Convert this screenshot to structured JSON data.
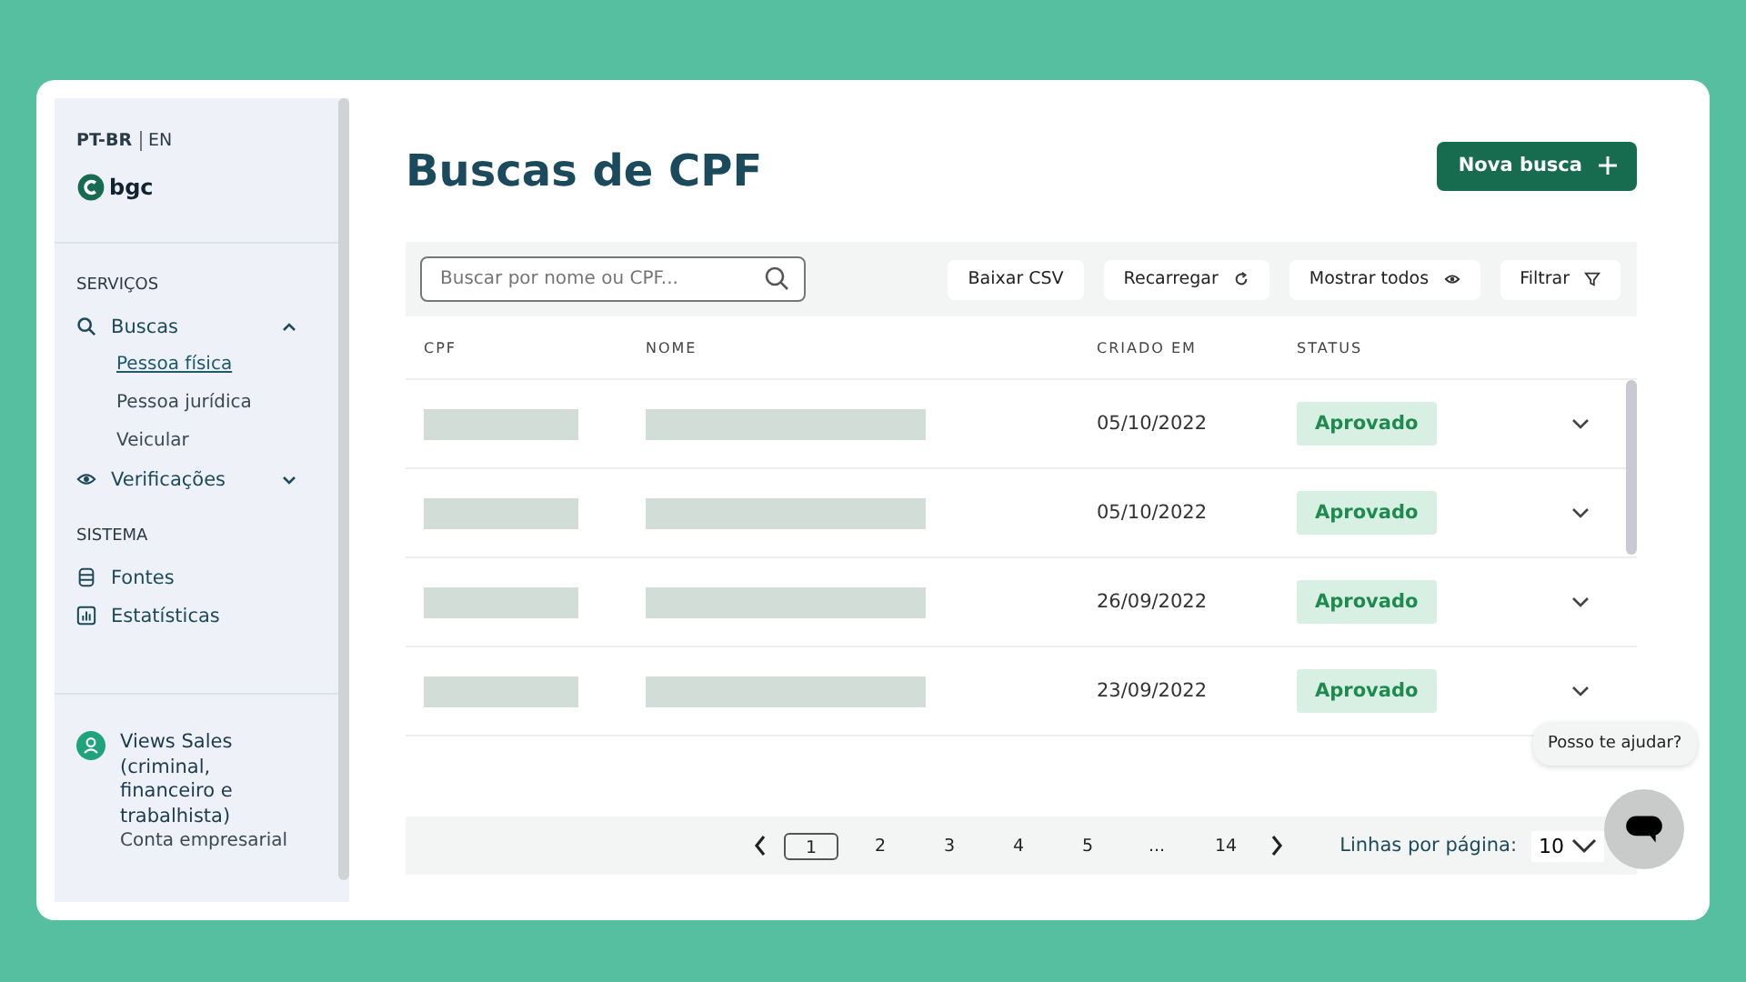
{
  "sidebar": {
    "languages": [
      {
        "label": "PT-BR",
        "selected": true
      },
      {
        "label": "EN",
        "selected": false
      }
    ],
    "brand": "bgc",
    "sections": [
      {
        "title": "SERVIÇOS",
        "items": [
          {
            "label": "Buscas",
            "kind": "search",
            "expanded": true,
            "children": [
              {
                "label": "Pessoa física",
                "selected": true
              },
              {
                "label": "Pessoa jurídica",
                "selected": false
              },
              {
                "label": "Veicular",
                "selected": false
              }
            ]
          },
          {
            "label": "Verificações",
            "kind": "eye",
            "expanded": false
          }
        ]
      },
      {
        "title": "SISTEMA",
        "items": [
          {
            "label": "Fontes",
            "kind": "database"
          },
          {
            "label": "Estatísticas",
            "kind": "chart"
          }
        ]
      }
    ],
    "account": {
      "name": "Views Sales (criminal, financeiro e trabalhista)",
      "type": "Conta empresarial"
    }
  },
  "page": {
    "title": "Buscas de CPF",
    "new_button": "Nova busca"
  },
  "toolbar": {
    "search": {
      "placeholder": "Buscar por nome ou CPF..."
    },
    "buttons": [
      {
        "label": "Baixar CSV",
        "kind": "plain"
      },
      {
        "label": "Recarregar",
        "kind": "reload"
      },
      {
        "label": "Mostrar todos",
        "kind": "eye"
      },
      {
        "label": "Filtrar",
        "kind": "filter"
      }
    ]
  },
  "table": {
    "columns": [
      "CPF",
      "NOME",
      "CRIADO EM",
      "STATUS"
    ],
    "rows": [
      {
        "created": "05/10/2022",
        "status": "Aprovado"
      },
      {
        "created": "05/10/2022",
        "status": "Aprovado"
      },
      {
        "created": "26/09/2022",
        "status": "Aprovado"
      },
      {
        "created": "23/09/2022",
        "status": "Aprovado"
      }
    ]
  },
  "pagination": {
    "pages": [
      {
        "label": "1",
        "selected": true
      },
      {
        "label": "2",
        "selected": false
      },
      {
        "label": "3",
        "selected": false
      },
      {
        "label": "4",
        "selected": false
      },
      {
        "label": "5",
        "selected": false
      },
      {
        "label": "...",
        "selected": false
      },
      {
        "label": "14",
        "selected": false
      }
    ],
    "rows_label": "Linhas por página:",
    "rows_value": "10"
  },
  "chat": {
    "bubble": "Posso te ajudar?"
  }
}
